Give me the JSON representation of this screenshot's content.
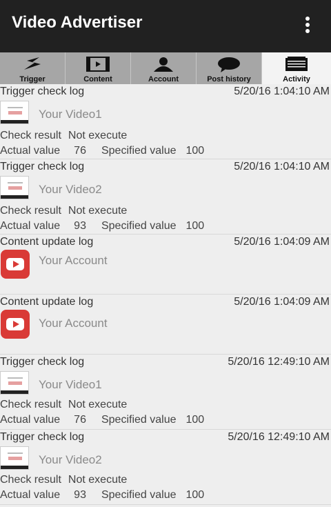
{
  "app": {
    "title": "Video Advertiser"
  },
  "tabs": [
    {
      "label": "Trigger",
      "icon": "lightning-icon"
    },
    {
      "label": "Content",
      "icon": "film-icon"
    },
    {
      "label": "Account",
      "icon": "person-icon"
    },
    {
      "label": "Post history",
      "icon": "speech-bubble-icon"
    },
    {
      "label": "Activity",
      "icon": "notepad-icon"
    }
  ],
  "labels": {
    "check_result": "Check result",
    "actual_value": "Actual value",
    "specified_value": "Specified value"
  },
  "entries": [
    {
      "header": "Trigger check log",
      "time": "5/20/16 1:04:10 AM",
      "name": "Your Video1",
      "result": "Not execute",
      "actual": "76",
      "specified": "100"
    },
    {
      "header": "Trigger check log",
      "time": "5/20/16 1:04:10 AM",
      "name": "Your Video2",
      "result": "Not execute",
      "actual": "93",
      "specified": "100"
    },
    {
      "header": "Content update log",
      "time": "5/20/16 1:04:09 AM",
      "name": "Your Account"
    },
    {
      "header": "Content update log",
      "time": "5/20/16 1:04:09 AM",
      "name": "Your Account"
    },
    {
      "header": "Trigger check log",
      "time": "5/20/16 12:49:10 AM",
      "name": "Your Video1",
      "result": "Not execute",
      "actual": "76",
      "specified": "100"
    },
    {
      "header": "Trigger check log",
      "time": "5/20/16 12:49:10 AM",
      "name": "Your Video2",
      "result": "Not execute",
      "actual": "93",
      "specified": "100"
    }
  ]
}
